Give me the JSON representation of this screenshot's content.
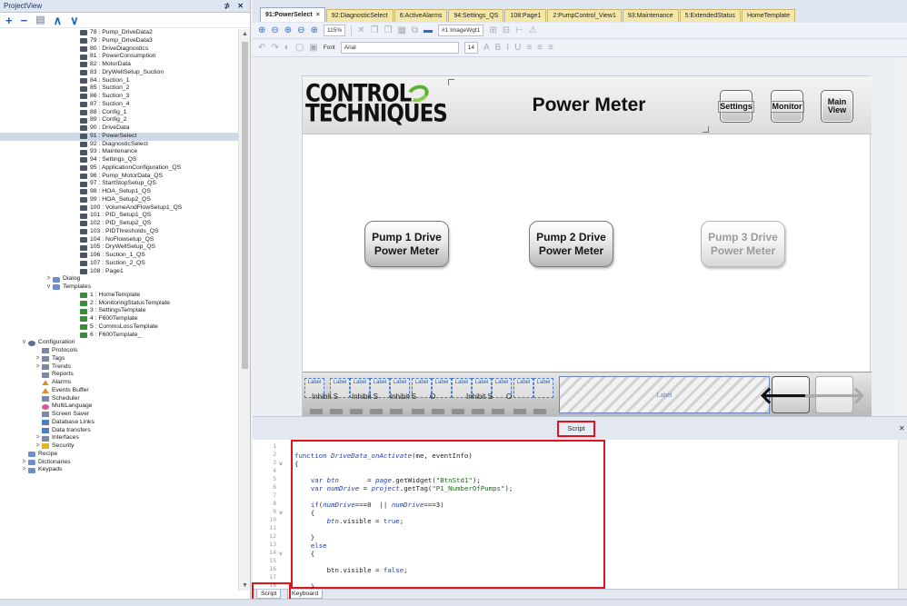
{
  "project_panel": {
    "title": "ProjectView",
    "window_buttons": "⊅ ✕",
    "tree": [
      {
        "indent": 88,
        "icon": "page",
        "label": "78 : Pump_DriveData2"
      },
      {
        "indent": 88,
        "icon": "page",
        "label": "79 : Pump_DriveData3"
      },
      {
        "indent": 88,
        "icon": "page",
        "label": "80 : DriveDiagnostics"
      },
      {
        "indent": 88,
        "icon": "page",
        "label": "81 : PowerConsumption"
      },
      {
        "indent": 88,
        "icon": "page",
        "label": "82 : MotorData"
      },
      {
        "indent": 88,
        "icon": "page",
        "label": "83 : DryWellSetup_Suction"
      },
      {
        "indent": 88,
        "icon": "page",
        "label": "84 : Suction_1"
      },
      {
        "indent": 88,
        "icon": "page",
        "label": "85 : Suction_2"
      },
      {
        "indent": 88,
        "icon": "page",
        "label": "86 : Suction_3"
      },
      {
        "indent": 88,
        "icon": "page",
        "label": "87 : Suction_4"
      },
      {
        "indent": 88,
        "icon": "page",
        "label": "88 : Config_1"
      },
      {
        "indent": 88,
        "icon": "page",
        "label": "89 : Config_2"
      },
      {
        "indent": 88,
        "icon": "page",
        "label": "90 : DriveData"
      },
      {
        "indent": 88,
        "icon": "page",
        "label": "91 : PowerSelect",
        "selected": true
      },
      {
        "indent": 88,
        "icon": "page",
        "label": "92 : DiagnosticSelect"
      },
      {
        "indent": 88,
        "icon": "page",
        "label": "93 : Maintenance"
      },
      {
        "indent": 88,
        "icon": "page",
        "label": "94 : Settings_QS"
      },
      {
        "indent": 88,
        "icon": "page",
        "label": "95 : ApplicationConfiguration_QS"
      },
      {
        "indent": 88,
        "icon": "page",
        "label": "96 : Pump_MotorData_QS"
      },
      {
        "indent": 88,
        "icon": "page",
        "label": "97 : StartStopSetup_QS"
      },
      {
        "indent": 88,
        "icon": "page",
        "label": "98 : HOA_Setup1_QS"
      },
      {
        "indent": 88,
        "icon": "page",
        "label": "99 : HOA_Setup2_QS"
      },
      {
        "indent": 88,
        "icon": "page",
        "label": "100 : VolumeAndFlowSetup1_QS"
      },
      {
        "indent": 88,
        "icon": "page",
        "label": "101 : PID_Setup1_QS"
      },
      {
        "indent": 88,
        "icon": "page",
        "label": "102 : PID_Setup2_QS"
      },
      {
        "indent": 88,
        "icon": "page",
        "label": "103 : PIDThresholds_QS"
      },
      {
        "indent": 88,
        "icon": "page",
        "label": "104 : NoFlowsetup_QS"
      },
      {
        "indent": 88,
        "icon": "page",
        "label": "105 : DryWellSetup_QS"
      },
      {
        "indent": 88,
        "icon": "page",
        "label": "106 : Suction_1_QS"
      },
      {
        "indent": 88,
        "icon": "page",
        "label": "107 : Suction_2_QS"
      },
      {
        "indent": 88,
        "icon": "page",
        "label": "108 : Page1"
      },
      {
        "indent": 58,
        "icon": "folder",
        "label": "Dialog",
        "chevron": ">"
      },
      {
        "indent": 58,
        "icon": "folder",
        "label": "Templates",
        "chevron": "v"
      },
      {
        "indent": 88,
        "icon": "template",
        "label": "1 : HomeTemplate"
      },
      {
        "indent": 88,
        "icon": "template",
        "label": "2 : MonitoringStatusTemplate"
      },
      {
        "indent": 88,
        "icon": "template",
        "label": "3 : SettingsTemplate"
      },
      {
        "indent": 88,
        "icon": "template",
        "label": "4 : F600Template"
      },
      {
        "indent": 88,
        "icon": "template",
        "label": "5 : CommsLossTemplate"
      },
      {
        "indent": 88,
        "icon": "template",
        "label": "6 : F600Template_"
      },
      {
        "indent": 31,
        "icon": "config",
        "label": "Configuration",
        "chevron": "v"
      },
      {
        "indent": 46,
        "icon": "generic",
        "label": "Protocols"
      },
      {
        "indent": 46,
        "icon": "generic",
        "label": "Tags",
        "chevron": ">"
      },
      {
        "indent": 46,
        "icon": "generic",
        "label": "Trends",
        "chevron": ">"
      },
      {
        "indent": 46,
        "icon": "generic",
        "label": "Reports"
      },
      {
        "indent": 46,
        "icon": "alarm",
        "label": "Alarms"
      },
      {
        "indent": 46,
        "icon": "alarm",
        "label": "Events Buffer"
      },
      {
        "indent": 46,
        "icon": "generic",
        "label": "Scheduler"
      },
      {
        "indent": 46,
        "icon": "lang",
        "label": "MultiLanguage"
      },
      {
        "indent": 46,
        "icon": "generic",
        "label": "Screen Saver"
      },
      {
        "indent": 46,
        "icon": "db",
        "label": "Database Links"
      },
      {
        "indent": 46,
        "icon": "db",
        "label": "Data transfers"
      },
      {
        "indent": 46,
        "icon": "generic",
        "label": "Interfaces",
        "chevron": ">"
      },
      {
        "indent": 46,
        "icon": "security",
        "label": "Security",
        "chevron": ">"
      },
      {
        "indent": 31,
        "icon": "folder",
        "label": "Recipe"
      },
      {
        "indent": 31,
        "icon": "folder",
        "label": "Dictionaries",
        "chevron": ">"
      },
      {
        "indent": 31,
        "icon": "folder",
        "label": "Keypads",
        "chevron": ">"
      }
    ]
  },
  "tabs": [
    {
      "label": "91:PowerSelect",
      "active": true
    },
    {
      "label": "92:DiagnosticSelect"
    },
    {
      "label": "6:ActiveAlarms"
    },
    {
      "label": "94:Settings_QS"
    },
    {
      "label": "108:Page1"
    },
    {
      "label": "2:PumpControl_View1"
    },
    {
      "label": "93:Maintenance"
    },
    {
      "label": "5:ExtendedStatus"
    },
    {
      "label": "HomeTemplate"
    }
  ],
  "toolbar": {
    "zoom": "115%",
    "widget_name": "#1 ImageWgt1",
    "font_label": "Font",
    "font_name": "Arial",
    "font_size": "14"
  },
  "canvas": {
    "logo_line1": "CONTROL",
    "logo_line2": "TECHNIQUES",
    "page_title": "Power Meter",
    "header_buttons": {
      "settings": "Settings",
      "monitor": "Monitor",
      "main_view_line1": "Main",
      "main_view_line2": "View"
    },
    "pump_buttons": [
      {
        "line1": "Pump 1 Drive",
        "line2": "Power Meter",
        "enabled": true
      },
      {
        "line1": "Pump 2 Drive",
        "line2": "Power Meter",
        "enabled": true
      },
      {
        "line1": "Pump 3 Drive",
        "line2": "Power Meter",
        "enabled": false
      }
    ],
    "bottom": {
      "mini_label": "Label",
      "inhibit_texts": [
        "Inhibit S",
        "Inhibit S",
        "Inhibit S",
        "O",
        "Inhibit S",
        "O"
      ],
      "hatched_label": "Label",
      "back_arrow": "🡐",
      "forward_arrow": "🡒"
    }
  },
  "script_panel": {
    "title": "Script",
    "close": "✕",
    "code": [
      {
        "ln": "1",
        "text": ""
      },
      {
        "ln": "2",
        "html": "<span class=\"kw\">function</span> <span class=\"fn\">DriveData_onActivate</span>(me, eventInfo)"
      },
      {
        "ln": "3",
        "fold": "v",
        "text": "{"
      },
      {
        "ln": "4",
        "text": ""
      },
      {
        "ln": "5",
        "html": "    <span class=\"kw\">var</span> <span class=\"var\">btn</span>       = <span class=\"var\">page</span>.getWidget(<span class=\"str\">\"BtnStd1\"</span>);"
      },
      {
        "ln": "6",
        "html": "    <span class=\"kw\">var</span> <span class=\"var\">numDrive</span> = <span class=\"var\">project</span>.getTag(<span class=\"str\">\"P1_NumberOfPumps\"</span>);"
      },
      {
        "ln": "7",
        "text": ""
      },
      {
        "ln": "8",
        "html": "    <span class=\"kw\">if</span>(<span class=\"var\">numDrive</span>===0  || <span class=\"var\">numDrive</span>===3)"
      },
      {
        "ln": "9",
        "fold": "v",
        "text": "    {"
      },
      {
        "ln": "10",
        "html": "        <span class=\"var\">btn</span>.visible = <span class=\"kw\">true</span>;"
      },
      {
        "ln": "11",
        "text": ""
      },
      {
        "ln": "12",
        "text": "    }"
      },
      {
        "ln": "13",
        "html": "    <span class=\"kw\">else</span>"
      },
      {
        "ln": "14",
        "fold": "v",
        "text": "    {"
      },
      {
        "ln": "15",
        "text": ""
      },
      {
        "ln": "16",
        "html": "        btn.visible = <span class=\"kw\">false</span>;"
      },
      {
        "ln": "17",
        "text": ""
      },
      {
        "ln": "18",
        "text": "    }"
      }
    ],
    "bottom_tabs": [
      "Script",
      "Keyboard"
    ]
  },
  "colors": {
    "highlight_red": "#e0151b",
    "selection_blue": "#4a7fd4",
    "tab_yellow": "#f6e7a7"
  }
}
